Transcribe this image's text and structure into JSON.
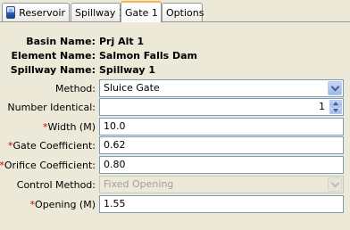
{
  "tabs": [
    {
      "label": "Reservoir",
      "icon": "reservoir-icon",
      "active": false
    },
    {
      "label": "Spillway 1",
      "active": false
    },
    {
      "label": "Gate 1",
      "active": true
    },
    {
      "label": "Options",
      "active": false
    }
  ],
  "info": {
    "basin_label": "Basin Name:",
    "basin_value": "Prj Alt 1",
    "element_label": "Element Name:",
    "element_value": "Salmon Falls Dam",
    "spillway_label": "Spillway Name:",
    "spillway_value": "Spillway 1"
  },
  "form": {
    "method": {
      "label": "Method:",
      "value": "Sluice Gate"
    },
    "number_identical": {
      "label": "Number Identical:",
      "value": "1"
    },
    "width": {
      "required": "*",
      "label": "Width (M)",
      "value": "10.0"
    },
    "gate_coefficient": {
      "required": "*",
      "label": "Gate Coefficient:",
      "value": "0.62"
    },
    "orifice_coefficient": {
      "required": "*",
      "label": "Orifice Coefficient:",
      "value": "0.80"
    },
    "control_method": {
      "label": "Control Method:",
      "value": "Fixed Opening"
    },
    "opening": {
      "required": "*",
      "label": "Opening (M)",
      "value": "1.55"
    }
  },
  "colors": {
    "required": "#d00000",
    "active_tab_accent": "#f9b545",
    "panel_bg": "#ece9d8"
  }
}
